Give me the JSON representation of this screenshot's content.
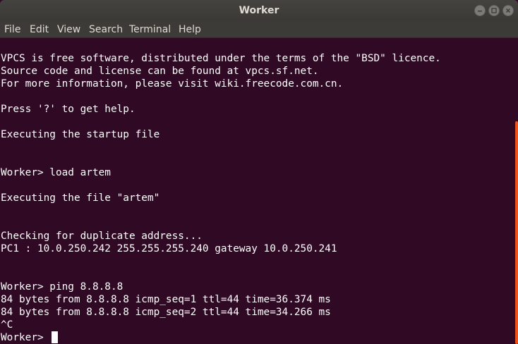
{
  "window": {
    "title": "Worker"
  },
  "menu": {
    "items": [
      "File",
      "Edit",
      "View",
      "Search",
      "Terminal",
      "Help"
    ]
  },
  "terminal": {
    "lines": [
      "VPCS is free software, distributed under the terms of the \"BSD\" licence.",
      "Source code and license can be found at vpcs.sf.net.",
      "For more information, please visit wiki.freecode.com.cn.",
      "",
      "Press '?' to get help.",
      "",
      "Executing the startup file",
      "",
      "",
      "Worker> load artem",
      "",
      "Executing the file \"artem\"",
      "",
      "",
      "Checking for duplicate address...",
      "PC1 : 10.0.250.242 255.255.255.240 gateway 10.0.250.241",
      "",
      "",
      "Worker> ping 8.8.8.8",
      "84 bytes from 8.8.8.8 icmp_seq=1 ttl=44 time=36.374 ms",
      "84 bytes from 8.8.8.8 icmp_seq=2 ttl=44 time=34.266 ms",
      "^C",
      "Worker> "
    ]
  },
  "colors": {
    "background": "#300a24",
    "text": "#ffffff",
    "titlebar": "#3c3b37",
    "scrollbar_accent": "#e95420"
  }
}
